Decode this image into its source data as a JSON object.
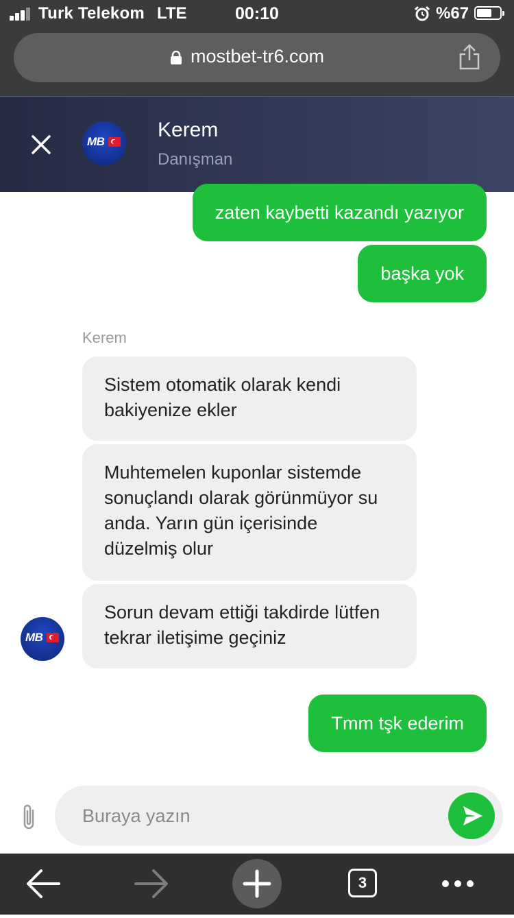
{
  "status_bar": {
    "carrier": "Turk Telekom",
    "network": "LTE",
    "time": "00:10",
    "battery_percent": "%67",
    "battery_level": 0.67,
    "signal_bars": 3
  },
  "browser": {
    "url": "mostbet-tr6.com",
    "open_tabs": "3"
  },
  "chat": {
    "agent_name": "Kerem",
    "agent_role": "Danışman",
    "avatar_text": "MB",
    "sender_label": "Kerem",
    "messages": [
      {
        "from": "user",
        "text": "zaten kaybetti kazandı yazıyor"
      },
      {
        "from": "user",
        "text": "başka yok"
      },
      {
        "from": "agent",
        "text": "Sistem otomatik olarak kendi bakiyenize ekler"
      },
      {
        "from": "agent",
        "text": "Muhtemelen kuponlar sistemde sonuçlandı olarak görünmüyor su anda. Yarın gün içerisinde düzelmiş olur"
      },
      {
        "from": "agent",
        "text": "Sorun devam ettiği takdirde lütfen tekrar iletişime geçiniz"
      },
      {
        "from": "user",
        "text": "Tmm tşk ederim"
      }
    ]
  },
  "composer": {
    "placeholder": "Buraya yazın",
    "value": ""
  },
  "colors": {
    "outgoing_bubble": "#1dbf3b",
    "incoming_bubble": "#efefef",
    "header_bg": "#2c3250",
    "browser_chrome": "#3a3b3d"
  }
}
